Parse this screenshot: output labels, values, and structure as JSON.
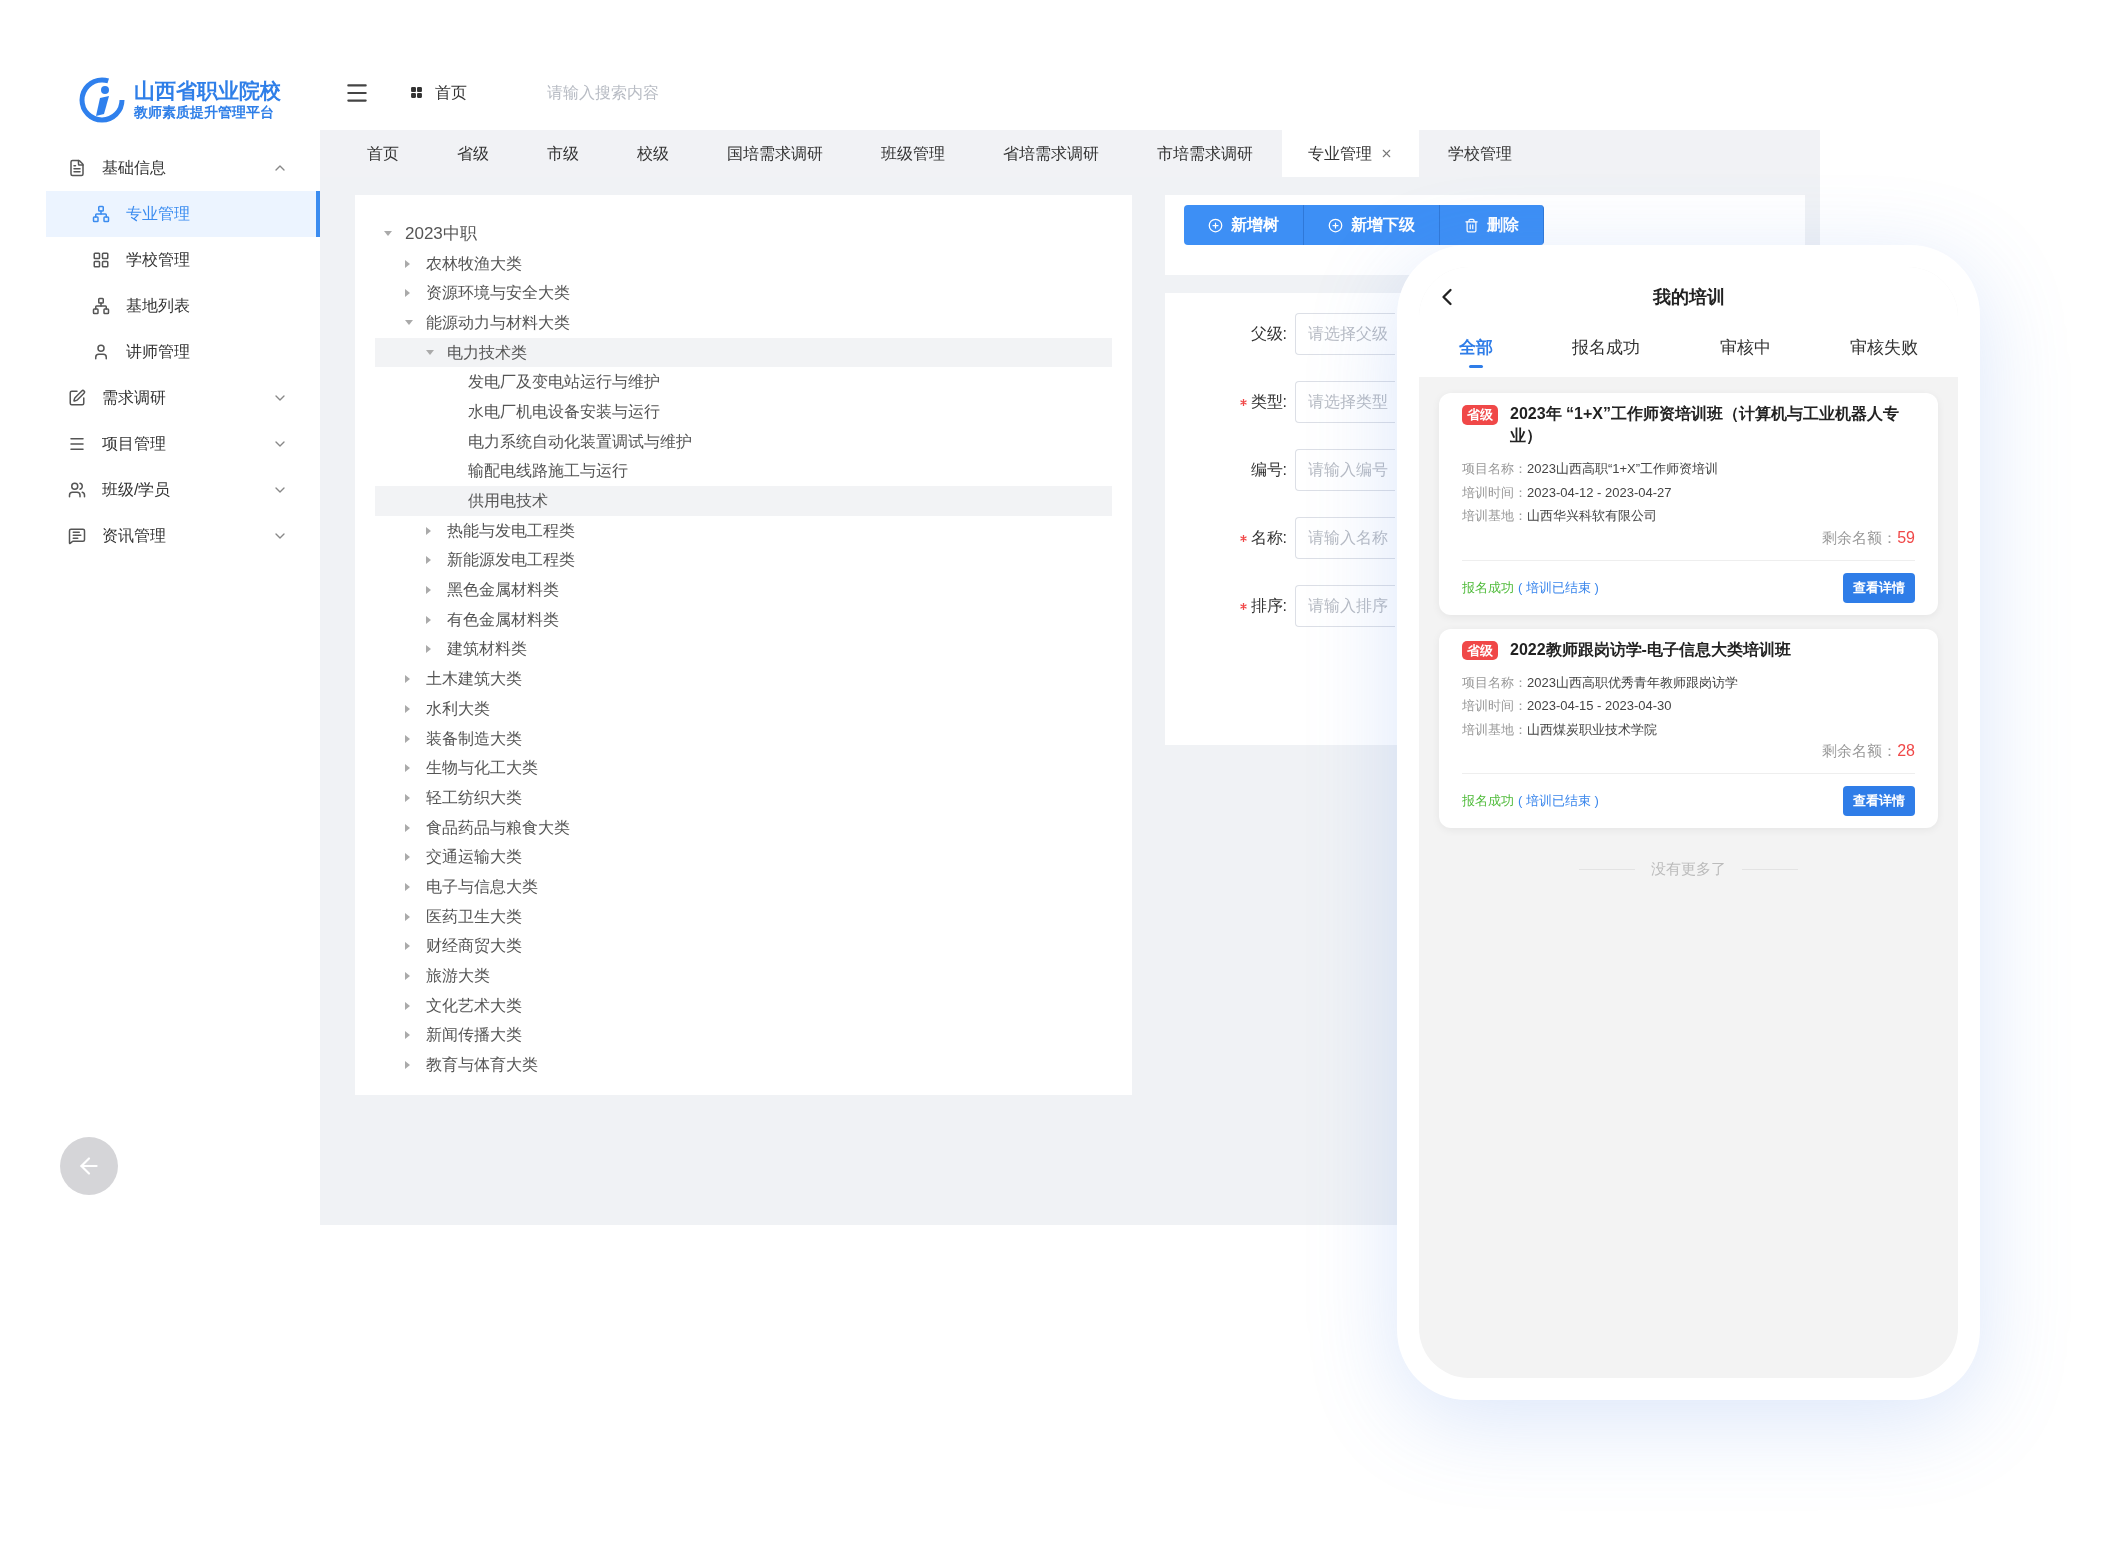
{
  "logo": {
    "title": "山西省职业院校",
    "subtitle": "教师素质提升管理平台"
  },
  "sidebar": {
    "items": [
      {
        "label": "基础信息",
        "expanded": true,
        "children": [
          {
            "label": "专业管理",
            "selected": true
          },
          {
            "label": "学校管理",
            "selected": false
          },
          {
            "label": "基地列表",
            "selected": false
          },
          {
            "label": "讲师管理",
            "selected": false
          }
        ]
      },
      {
        "label": "需求调研",
        "expanded": false
      },
      {
        "label": "项目管理",
        "expanded": false
      },
      {
        "label": "班级/学员",
        "expanded": false
      },
      {
        "label": "资讯管理",
        "expanded": false
      }
    ]
  },
  "header": {
    "home_label": "首页",
    "search": {
      "placeholder": "请输入搜索内容"
    }
  },
  "tabs": [
    {
      "label": "首页",
      "selected": false
    },
    {
      "label": "省级",
      "selected": false
    },
    {
      "label": "市级",
      "selected": false
    },
    {
      "label": "校级",
      "selected": false
    },
    {
      "label": "国培需求调研",
      "selected": false
    },
    {
      "label": "班级管理",
      "selected": false
    },
    {
      "label": "省培需求调研",
      "selected": false
    },
    {
      "label": "市培需求调研",
      "selected": false
    },
    {
      "label": "专业管理",
      "selected": true
    },
    {
      "label": "学校管理",
      "selected": false
    }
  ],
  "tree": [
    {
      "label": "2023中职",
      "expanded": true,
      "highlighted": false,
      "children": [
        {
          "label": "农林牧渔大类",
          "expanded": false,
          "highlighted": false
        },
        {
          "label": "资源环境与安全大类",
          "expanded": false,
          "highlighted": false
        },
        {
          "label": "能源动力与材料大类",
          "expanded": true,
          "highlighted": false,
          "children": [
            {
              "label": "电力技术类",
              "expanded": true,
              "highlighted": true,
              "children": [
                {
                  "label": "发电厂及变电站运行与维护",
                  "highlighted": false
                },
                {
                  "label": "水电厂机电设备安装与运行",
                  "highlighted": false
                },
                {
                  "label": "电力系统自动化装置调试与维护",
                  "highlighted": false
                },
                {
                  "label": "输配电线路施工与运行",
                  "highlighted": false
                },
                {
                  "label": "供用电技术",
                  "highlighted": true
                }
              ]
            },
            {
              "label": "热能与发电工程类",
              "expanded": false,
              "highlighted": false
            },
            {
              "label": "新能源发电工程类",
              "expanded": false,
              "highlighted": false
            },
            {
              "label": "黑色金属材料类",
              "expanded": false,
              "highlighted": false
            },
            {
              "label": "有色金属材料类",
              "expanded": false,
              "highlighted": false
            },
            {
              "label": "建筑材料类",
              "expanded": false,
              "highlighted": false
            }
          ]
        },
        {
          "label": "土木建筑大类",
          "expanded": false,
          "highlighted": false
        },
        {
          "label": "水利大类",
          "expanded": false,
          "highlighted": false
        },
        {
          "label": "装备制造大类",
          "expanded": false,
          "highlighted": false
        },
        {
          "label": "生物与化工大类",
          "expanded": false,
          "highlighted": false
        },
        {
          "label": "轻工纺织大类",
          "expanded": false,
          "highlighted": false
        },
        {
          "label": "食品药品与粮食大类",
          "expanded": false,
          "highlighted": false
        },
        {
          "label": "交通运输大类",
          "expanded": false,
          "highlighted": false
        },
        {
          "label": "电子与信息大类",
          "expanded": false,
          "highlighted": false
        },
        {
          "label": "医药卫生大类",
          "expanded": false,
          "highlighted": false
        },
        {
          "label": "财经商贸大类",
          "expanded": false,
          "highlighted": false
        },
        {
          "label": "旅游大类",
          "expanded": false,
          "highlighted": false
        },
        {
          "label": "文化艺术大类",
          "expanded": false,
          "highlighted": false
        },
        {
          "label": "新闻传播大类",
          "expanded": false,
          "highlighted": false
        },
        {
          "label": "教育与体育大类",
          "expanded": false,
          "highlighted": false
        }
      ]
    }
  ],
  "toolbar": [
    {
      "label": "新增树",
      "kind": "add"
    },
    {
      "label": "新增下级",
      "kind": "add"
    },
    {
      "label": "删除",
      "kind": "delete"
    }
  ],
  "form": [
    {
      "label": "父级:",
      "required": false,
      "placeholder": "请选择父级"
    },
    {
      "label": "类型:",
      "required": true,
      "placeholder": "请选择类型"
    },
    {
      "label": "编号:",
      "required": false,
      "placeholder": "请输入编号"
    },
    {
      "label": "名称:",
      "required": true,
      "placeholder": "请输入名称"
    },
    {
      "label": "排序:",
      "required": true,
      "placeholder": "请输入排序"
    }
  ],
  "phone": {
    "title": "我的培训",
    "tabs": [
      {
        "label": "全部",
        "selected": true
      },
      {
        "label": "报名成功",
        "selected": false
      },
      {
        "label": "审核中",
        "selected": false
      },
      {
        "label": "审核失败",
        "selected": false
      }
    ],
    "cards": [
      {
        "badge": "省级",
        "title": "2023年 “1+X”工作师资培训班（计算机与工业机器人专业）",
        "fields": [
          {
            "label": "项目名称：",
            "value": "2023山西高职“1+X”工作师资培训"
          },
          {
            "label": "培训时间：",
            "value": "2023-04-12 - 2023-04-27"
          },
          {
            "label": "培训基地：",
            "value": "山西华兴科软有限公司"
          }
        ],
        "remaining_label": "剩余名额：",
        "remaining": "59",
        "status": "报名成功",
        "status_note": "( 培训已结束 )",
        "button": "查看详情"
      },
      {
        "badge": "省级",
        "title": "2022教师跟岗访学-电子信息大类培训班",
        "fields": [
          {
            "label": "项目名称：",
            "value": "2023山西高职优秀青年教师跟岗访学"
          },
          {
            "label": "培训时间：",
            "value": "2023-04-15 - 2023-04-30"
          },
          {
            "label": "培训基地：",
            "value": "山西煤炭职业技术学院"
          }
        ],
        "remaining_label": "剩余名额：",
        "remaining": "28",
        "status": "报名成功",
        "status_note": "( 培训已结束 )",
        "button": "查看详情"
      }
    ],
    "footer": "没有更多了"
  }
}
